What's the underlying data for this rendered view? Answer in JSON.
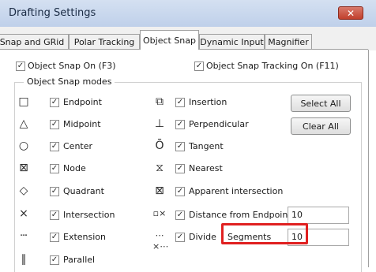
{
  "window": {
    "title": "Drafting Settings",
    "close_label": "✕"
  },
  "tabs": [
    {
      "label": "Snap and GRid",
      "active": false
    },
    {
      "label": "Polar Tracking",
      "active": false
    },
    {
      "label": "Object Snap",
      "active": true
    },
    {
      "label": "Dynamic Input",
      "active": false
    },
    {
      "label": "Magnifier",
      "active": false
    }
  ],
  "top_options": {
    "osnap_on": {
      "label": "Object Snap On (F3)",
      "checked": true
    },
    "osnap_tracking": {
      "label": "Object Snap Tracking On (F11)",
      "checked": true
    }
  },
  "group_label": "Object Snap modes",
  "modes_left": [
    {
      "label": "Endpoint",
      "icon": "endpoint-icon",
      "checked": true
    },
    {
      "label": "Midpoint",
      "icon": "midpoint-icon",
      "checked": true
    },
    {
      "label": "Center",
      "icon": "center-icon",
      "checked": true
    },
    {
      "label": "Node",
      "icon": "node-icon",
      "checked": true
    },
    {
      "label": "Quadrant",
      "icon": "quadrant-icon",
      "checked": true
    },
    {
      "label": "Intersection",
      "icon": "intersection-icon",
      "checked": true
    },
    {
      "label": "Extension",
      "icon": "extension-icon",
      "checked": true
    },
    {
      "label": "Parallel",
      "icon": "parallel-icon",
      "checked": true
    }
  ],
  "modes_right": [
    {
      "label": "Insertion",
      "icon": "insertion-icon",
      "checked": true
    },
    {
      "label": "Perpendicular",
      "icon": "perpendicular-icon",
      "checked": true
    },
    {
      "label": "Tangent",
      "icon": "tangent-icon",
      "checked": true
    },
    {
      "label": "Nearest",
      "icon": "nearest-icon",
      "checked": true
    },
    {
      "label": "Apparent intersection",
      "icon": "apparent-intersection-icon",
      "checked": true
    },
    {
      "label": "Distance from Endpoint",
      "icon": "distance-from-endpoint-icon",
      "checked": true
    },
    {
      "label": "Divide",
      "icon": "divide-icon",
      "checked": true
    }
  ],
  "buttons": {
    "select_all": "Select All",
    "clear_all": "Clear All"
  },
  "distance_value": "10",
  "divide": {
    "segments_label": "Segments",
    "segments_value": "10"
  },
  "check_mark": "✓",
  "colors": {
    "highlight": "#e02020",
    "title_bg": "#c9d8ee",
    "close_bg": "#c7493a"
  }
}
